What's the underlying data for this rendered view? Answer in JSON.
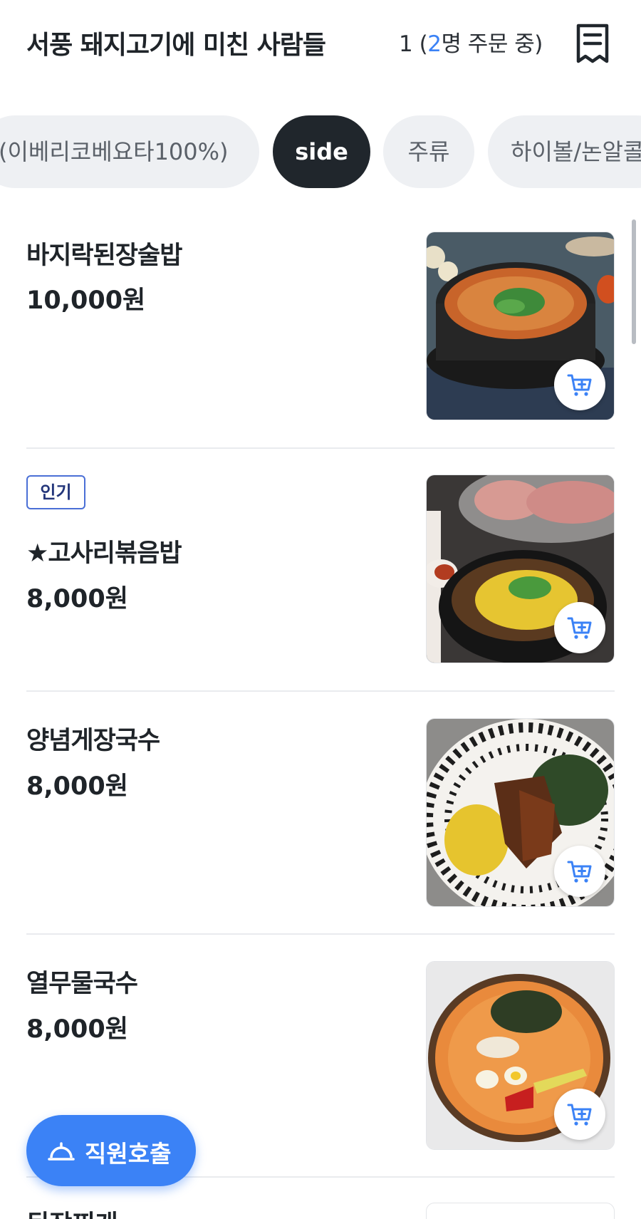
{
  "header": {
    "store_name": "서풍 돼지고기에 미친 사람들",
    "table_number": "1",
    "order_open": "(",
    "order_count": "2",
    "order_suffix": "명 주문 중)"
  },
  "tabs": [
    {
      "label": "(이베리코베요타100%)",
      "active": false
    },
    {
      "label": "side",
      "active": true
    },
    {
      "label": "주류",
      "active": false
    },
    {
      "label": "하이볼/논알콜",
      "active": false
    }
  ],
  "menu": [
    {
      "name": "바지락된장술밥",
      "price": "10,000원",
      "badge": ""
    },
    {
      "name": "★고사리볶음밥",
      "price": "8,000원",
      "badge": "인기"
    },
    {
      "name": "양념게장국수",
      "price": "8,000원",
      "badge": ""
    },
    {
      "name": "열무물국수",
      "price": "8,000원",
      "badge": ""
    }
  ],
  "next_item": {
    "name": "된장찌개"
  },
  "call_staff": {
    "label": "직원호출"
  },
  "colors": {
    "accent": "#3b82f6",
    "tab_active": "#20262c",
    "tab_inactive": "#eef0f3"
  }
}
